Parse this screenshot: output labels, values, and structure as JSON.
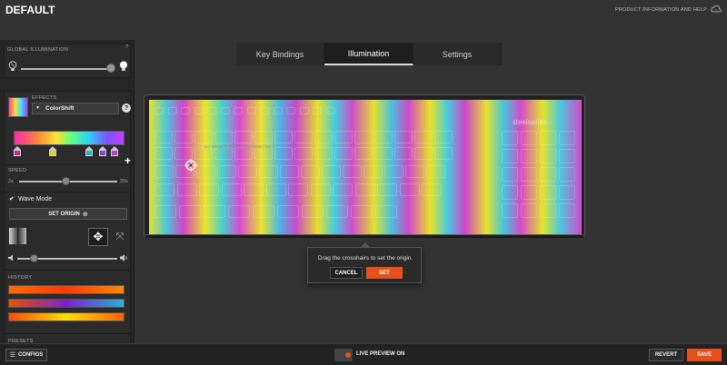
{
  "app": {
    "title": "DEFAULT",
    "help_link": "PRODUCT INFORMATION AND HELP"
  },
  "sidebar": {
    "global_illumination": {
      "label": "GLOBAL ILLUMINATION",
      "level": 0.95,
      "help": "?"
    },
    "effects": {
      "label": "EFFECTS",
      "selected": "ColorShift",
      "help": "?"
    },
    "gradient_stop_colors": [
      "#c82f8f",
      "#d8d41f",
      "#2bb0c4",
      "#8a4ad0",
      "#b040d0"
    ],
    "speed": {
      "label": "SPEED",
      "min_label": "2s",
      "max_label": "30s",
      "level": 0.45
    },
    "wave_mode": {
      "label": "Wave Mode",
      "checked": true
    },
    "set_origin_label": "SET ORIGIN",
    "volume_level": 0.15,
    "history": {
      "label": "HISTORY",
      "swatches": [
        [
          "#ff6a00",
          "#ff3b00",
          "#ff8800"
        ],
        [
          "#e05400",
          "#7a20d0",
          "#2ab0d8"
        ],
        [
          "#ff4a00",
          "#ffe000",
          "#ff6000"
        ]
      ]
    },
    "presets_label": "PRESETS"
  },
  "tabs": [
    {
      "label": "Key Bindings",
      "active": false
    },
    {
      "label": "Illumination",
      "active": true
    },
    {
      "label": "Settings",
      "active": false
    }
  ],
  "keyboard": {
    "brand": "steelseries",
    "footer_text": "SET ORIGIN TO CHANGE WAVE DIRECTION"
  },
  "popup": {
    "message": "Drag the crosshairs to set the origin.",
    "cancel_label": "CANCEL",
    "set_label": "SET"
  },
  "bottom": {
    "configs_label": "CONFIGS",
    "live_preview_label": "LIVE PREVIEW ON",
    "revert_label": "REVERT",
    "save_label": "SAVE"
  },
  "colors": {
    "accent": "#e8501a"
  }
}
